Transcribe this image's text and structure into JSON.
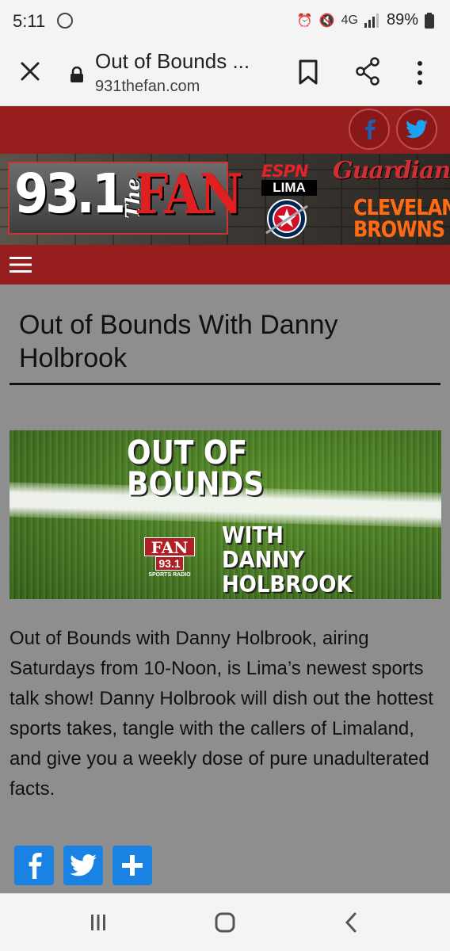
{
  "status_bar": {
    "time": "5:11",
    "network": "4G",
    "battery": "89%"
  },
  "browser": {
    "title": "Out of Bounds ...",
    "url": "931thefan.com"
  },
  "site": {
    "logo_number": "93.1",
    "logo_the": "The",
    "logo_fan": "FAN",
    "espn_label": "ESPN",
    "espn_city": "LIMA",
    "guardians": "Guardians",
    "browns_line1": "CLEVELAND",
    "browns_line2": "BROWNS",
    "brand_color": "#971e1e"
  },
  "article": {
    "title": "Out of Bounds With Danny Holbrook",
    "hero": {
      "line1": "OUT OF",
      "line2": "BOUNDS",
      "with": "WITH",
      "name1": "DANNY",
      "name2": "HOLBROOK",
      "logo_fan": "FAN",
      "logo_num": "93.1",
      "logo_sub": "SPORTS RADIO"
    },
    "description": "Out of Bounds with Danny Holbrook, airing Saturdays from 10-Noon, is Lima’s newest sports talk show! Danny Holbrook will dish out the hottest sports takes, tangle with the callers of Limaland, and give you a weekly dose of pure unadulterated facts."
  },
  "share": {
    "color": "#1a82e2"
  }
}
